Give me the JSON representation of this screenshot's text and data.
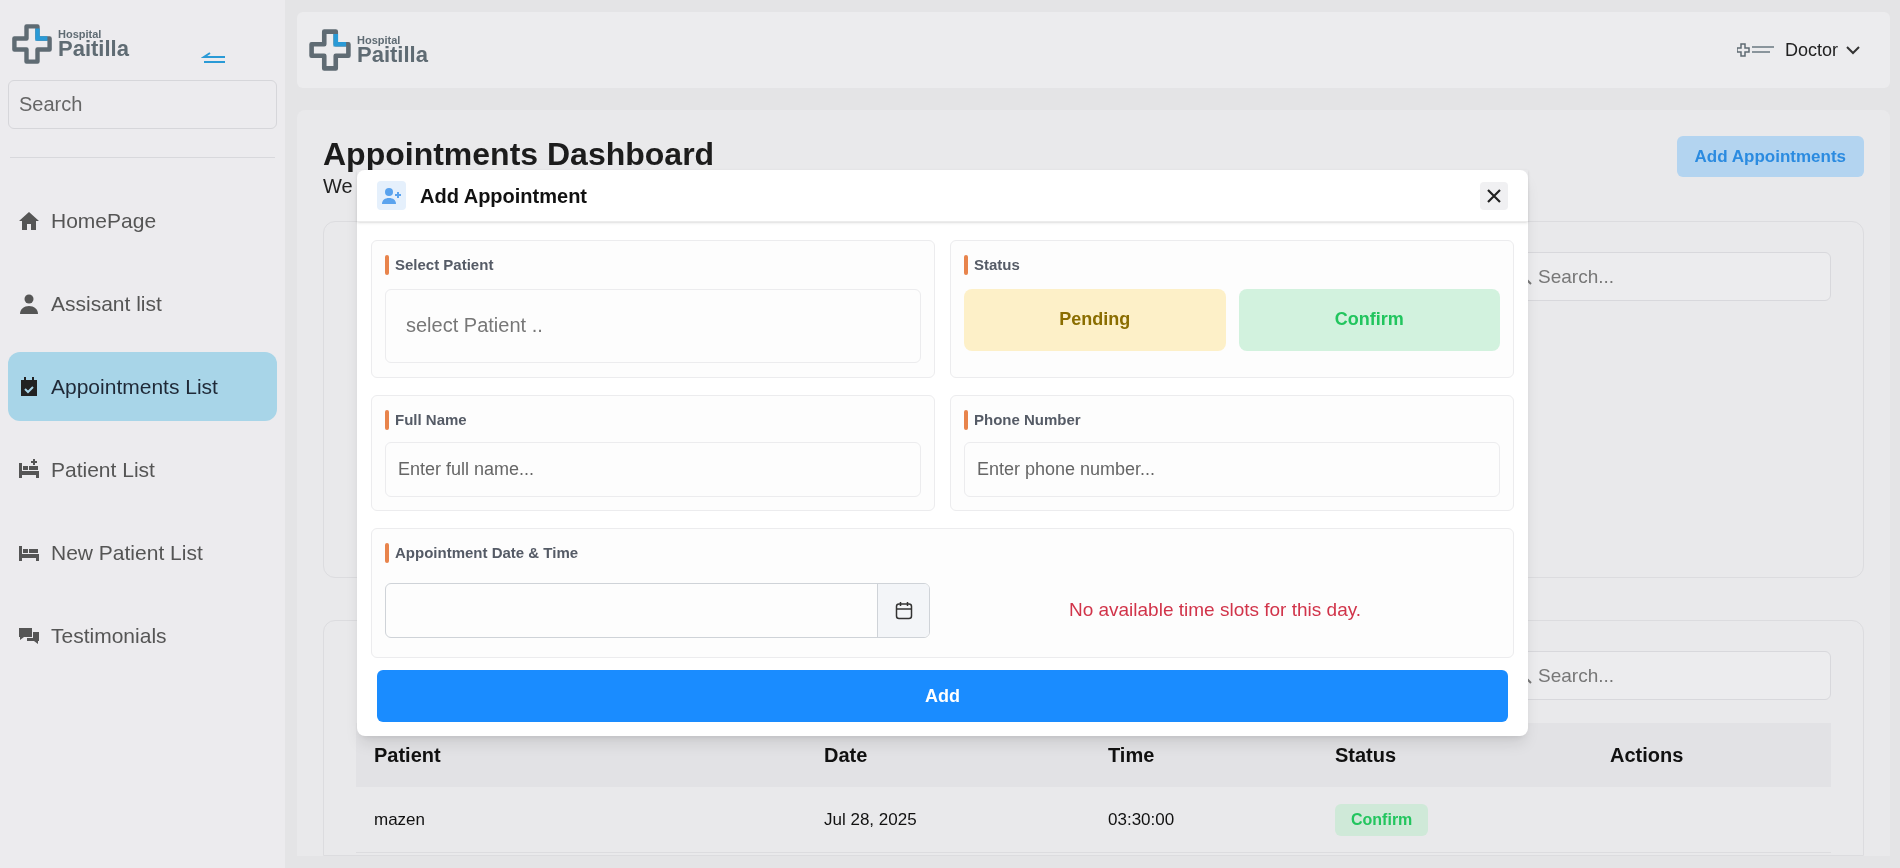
{
  "sidebar": {
    "logo": {
      "small": "Hospital",
      "name": "Paitilla"
    },
    "search": {
      "placeholder": "Search"
    },
    "items": [
      {
        "label": "HomePage",
        "kind": "home",
        "selected": false
      },
      {
        "label": "Assisant list",
        "kind": "person",
        "selected": false
      },
      {
        "label": "Appointments List",
        "kind": "calendar",
        "selected": true
      },
      {
        "label": "Patient List",
        "kind": "bed-plus",
        "selected": false
      },
      {
        "label": "New Patient List",
        "kind": "bed",
        "selected": false
      },
      {
        "label": "Testimonials",
        "kind": "chat",
        "selected": false
      }
    ]
  },
  "header": {
    "logo": {
      "small": "Hospital",
      "name": "Paitilla"
    },
    "user": "Doctor"
  },
  "page": {
    "title": "Appointments Dashboard",
    "subtitle": "We",
    "add_button": "Add Appointments"
  },
  "filter_card": {
    "search": {
      "placeholder": "Search..."
    }
  },
  "table_card": {
    "search": {
      "placeholder": "Search..."
    },
    "columns": [
      "Patient",
      "Date",
      "Time",
      "Status",
      "Actions"
    ],
    "rows": [
      {
        "patient": "mazen",
        "date": "Jul 28, 2025",
        "time": "03:30:00",
        "status": {
          "label": "Confirm",
          "kind": "confirm"
        }
      }
    ]
  },
  "modal": {
    "title": "Add Appointment",
    "select_patient": {
      "label": "Select Patient",
      "placeholder": "select Patient .."
    },
    "status": {
      "label": "Status",
      "options": [
        {
          "label": "Pending",
          "kind": "pending",
          "selected": false
        },
        {
          "label": "Confirm",
          "kind": "confirm",
          "selected": false
        }
      ]
    },
    "full_name": {
      "label": "Full Name",
      "placeholder": "Enter full name..."
    },
    "phone": {
      "label": "Phone Number",
      "placeholder": "Enter phone number..."
    },
    "date_time": {
      "label": "Appointment Date & Time",
      "message": "No available time slots for this day."
    },
    "submit": "Add"
  }
}
